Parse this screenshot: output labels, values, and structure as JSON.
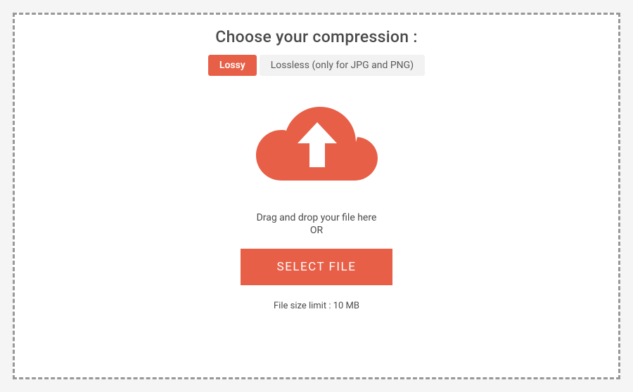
{
  "header": {
    "title": "Choose your compression :"
  },
  "segmented": {
    "options": [
      {
        "label": "Lossy",
        "active": true
      },
      {
        "label": "Lossless (only for JPG and PNG)",
        "active": false
      }
    ]
  },
  "upload": {
    "drag_text": "Drag and drop your file here",
    "or_text": "OR",
    "select_button_label": "SELECT FILE",
    "limit_text": "File size limit : 10 MB"
  },
  "colors": {
    "accent": "#e85f47",
    "inactive_bg": "#f2f2f2",
    "text": "#4a4a4a",
    "border": "#989898"
  }
}
